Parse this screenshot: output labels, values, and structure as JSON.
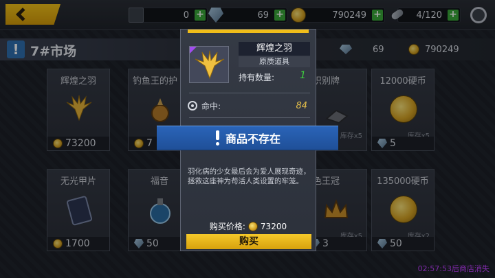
{
  "topbar": {
    "res1_value": "0",
    "res2_value": "69",
    "res3_value": "790249",
    "res4_value": "4/120"
  },
  "shop": {
    "title": "7#市场",
    "gems": "69",
    "coins": "790249"
  },
  "cards": [
    {
      "name": "辉煌之羽",
      "price": "73200",
      "stock": "",
      "price_icon": "coin-icon"
    },
    {
      "name": "钓鱼王的护",
      "price": "7",
      "stock": "",
      "price_icon": "coin-icon"
    },
    {
      "name": "识别牌",
      "price": "",
      "stock": "库存x5",
      "price_icon": "gem-icon"
    },
    {
      "name": "12000硬币",
      "price": "5",
      "stock": "库存x5",
      "price_icon": "gem-icon"
    },
    {
      "name": "无光甲片",
      "price": "1700",
      "stock": "",
      "price_icon": "coin-icon"
    },
    {
      "name": "福音",
      "price": "50",
      "stock": "",
      "price_icon": "gem-icon"
    },
    {
      "name": "色王冠",
      "price": "3",
      "stock": "库存x5",
      "price_icon": "gem-icon"
    },
    {
      "name": "135000硬币",
      "price": "50",
      "stock": "库存x2",
      "price_icon": "gem-icon"
    }
  ],
  "popup": {
    "item_name": "辉煌之羽",
    "item_type": "原质道具",
    "owned_label": "持有数量:",
    "owned_value": "1",
    "stat_label": "命中:",
    "stat_value": "84",
    "description": "羽化病的少女最后会为爱人展现奇迹，拯救这座神为苟活人类设置的牢笼。",
    "buy_price_label": "购买价格:",
    "buy_price_value": "73200",
    "buy_button": "购买"
  },
  "notice": {
    "text": "商品不存在"
  },
  "timer": "02:57:53后商店消失",
  "colors": {
    "accent_yellow": "#f0bd1a",
    "notice_blue": "#2a64b8",
    "owned_green": "#3ed13e",
    "timer_purple": "#c040ff"
  }
}
